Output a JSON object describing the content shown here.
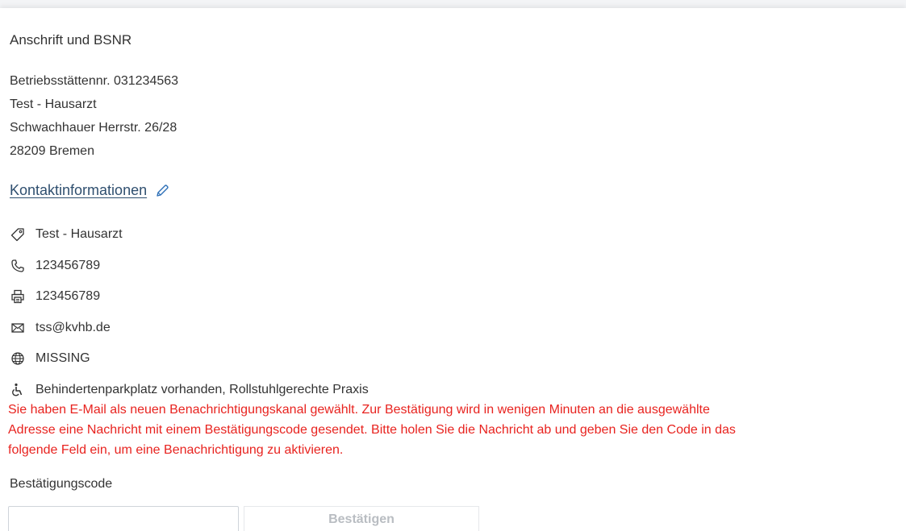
{
  "address_section": {
    "title": "Anschrift und BSNR",
    "lines": [
      "Betriebsstättennr. 031234563",
      "Test - Hausarzt",
      "Schwachhauer Herrstr. 26/28",
      "28209 Bremen"
    ]
  },
  "contact_section": {
    "title": "Kontaktinformationen",
    "edit_icon": "pencil-icon",
    "items": [
      {
        "icon": "tag-icon",
        "value": "Test - Hausarzt"
      },
      {
        "icon": "phone-icon",
        "value": "123456789"
      },
      {
        "icon": "printer-icon",
        "value": "123456789"
      },
      {
        "icon": "mail-icon",
        "value": "tss@kvhb.de"
      },
      {
        "icon": "globe-icon",
        "value": "MISSING"
      },
      {
        "icon": "wheelchair-icon",
        "value": "Behindertenparkplatz vorhanden, Rollstuhlgerechte Praxis"
      }
    ]
  },
  "notice": {
    "lines": [
      "Sie haben E-Mail als neuen Benachrichtigungskanal gewählt. Zur Bestätigung wird in wenigen Minuten an die ausgewählte",
      "Adresse eine Nachricht mit einem Bestätigungscode gesendet. Bitte holen Sie die Nachricht ab und geben Sie den Code in das",
      "folgende Feld ein, um eine Benachrichtigung zu aktivieren."
    ],
    "color": "#e8231f"
  },
  "confirmation": {
    "label": "Bestätigungscode",
    "input_value": "",
    "button_label": "Bestätigen"
  },
  "colors": {
    "text": "#333333",
    "link": "#2f4f6f",
    "accent_icon": "#2c6fb7",
    "disabled_button_text": "#b9bdc2"
  }
}
